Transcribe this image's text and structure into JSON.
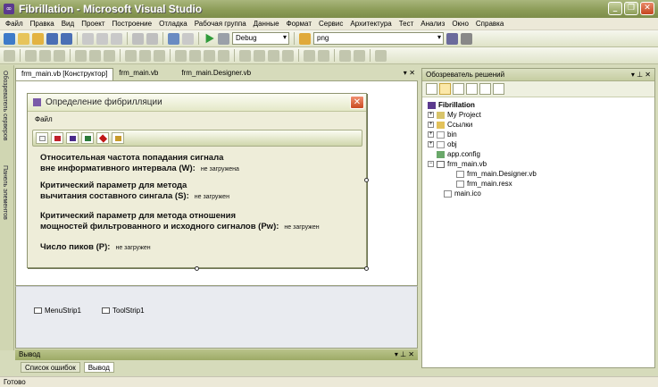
{
  "window": {
    "title": "Fibrillation - Microsoft Visual Studio"
  },
  "menu": [
    "Файл",
    "Правка",
    "Вид",
    "Проект",
    "Построение",
    "Отладка",
    "Рабочая группа",
    "Данные",
    "Формат",
    "Сервис",
    "Архитектура",
    "Тест",
    "Анализ",
    "Окно",
    "Справка"
  ],
  "toolbar": {
    "config": "Debug",
    "find": "png"
  },
  "left_tabs": {
    "server": "Обозреватель серверов",
    "toolbox": "Панель элементов"
  },
  "doc_tabs": [
    "frm_main.vb [Конструктор]",
    "frm_main.vb",
    "frm_main.Designer.vb"
  ],
  "form": {
    "title": "Определение фибрилляции",
    "menu_file": "Файл",
    "labels": [
      {
        "line1": "Относительная частота попадания сигнала",
        "line2": "вне информативного интервала (W):",
        "value": "не загружена"
      },
      {
        "line1": "Критический параметр для метода",
        "line2": "вычитания составного сингала (S):",
        "value": "не загружен"
      },
      {
        "line1": "Критический параметр для метода отношения",
        "line2": "мощностей фильтрованного и исходного сигналов (Pw):",
        "value": "не загружен"
      },
      {
        "line1": "",
        "line2": "Число пиков (P):",
        "value": "не загружен"
      }
    ]
  },
  "tray": {
    "menustrip": "MenuStrip1",
    "toolstrip": "ToolStrip1"
  },
  "output": {
    "title": "Вывод",
    "tab_errors": "Список ошибок",
    "tab_output": "Вывод"
  },
  "solution": {
    "title": "Обозреватель решений",
    "items": [
      "Fibrillation",
      "My Project",
      "Ссылки",
      "bin",
      "obj",
      "app.config",
      "frm_main.vb",
      "frm_main.Designer.vb",
      "frm_main.resx",
      "main.ico"
    ]
  },
  "status": "Готово"
}
